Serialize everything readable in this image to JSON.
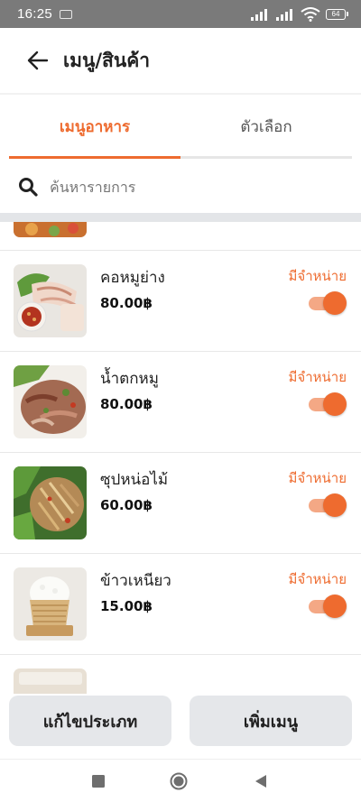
{
  "status_bar": {
    "time": "16:25",
    "battery": "64"
  },
  "header": {
    "title": "เมนู/สินค้า"
  },
  "tabs": [
    {
      "label": "เมนูอาหาร",
      "active": true
    },
    {
      "label": "ตัวเลือก",
      "active": false
    }
  ],
  "search": {
    "placeholder": "ค้นหารายการ"
  },
  "items": [
    {
      "name": "คอหมูย่าง",
      "price": "80.00฿",
      "status": "มีจำหน่าย",
      "available": true
    },
    {
      "name": "น้ำตกหมู",
      "price": "80.00฿",
      "status": "มีจำหน่าย",
      "available": true
    },
    {
      "name": "ซุปหน่อไม้",
      "price": "60.00฿",
      "status": "มีจำหน่าย",
      "available": true
    },
    {
      "name": "ข้าวเหนียว",
      "price": "15.00฿",
      "status": "มีจำหน่าย",
      "available": true
    }
  ],
  "actions": {
    "edit_category": "แก้ไขประเภท",
    "add_menu": "เพิ่มเมนู"
  },
  "colors": {
    "accent": "#ee6b2f",
    "toggle_track": "#f4a885",
    "button_bg": "#e5e7ea"
  }
}
